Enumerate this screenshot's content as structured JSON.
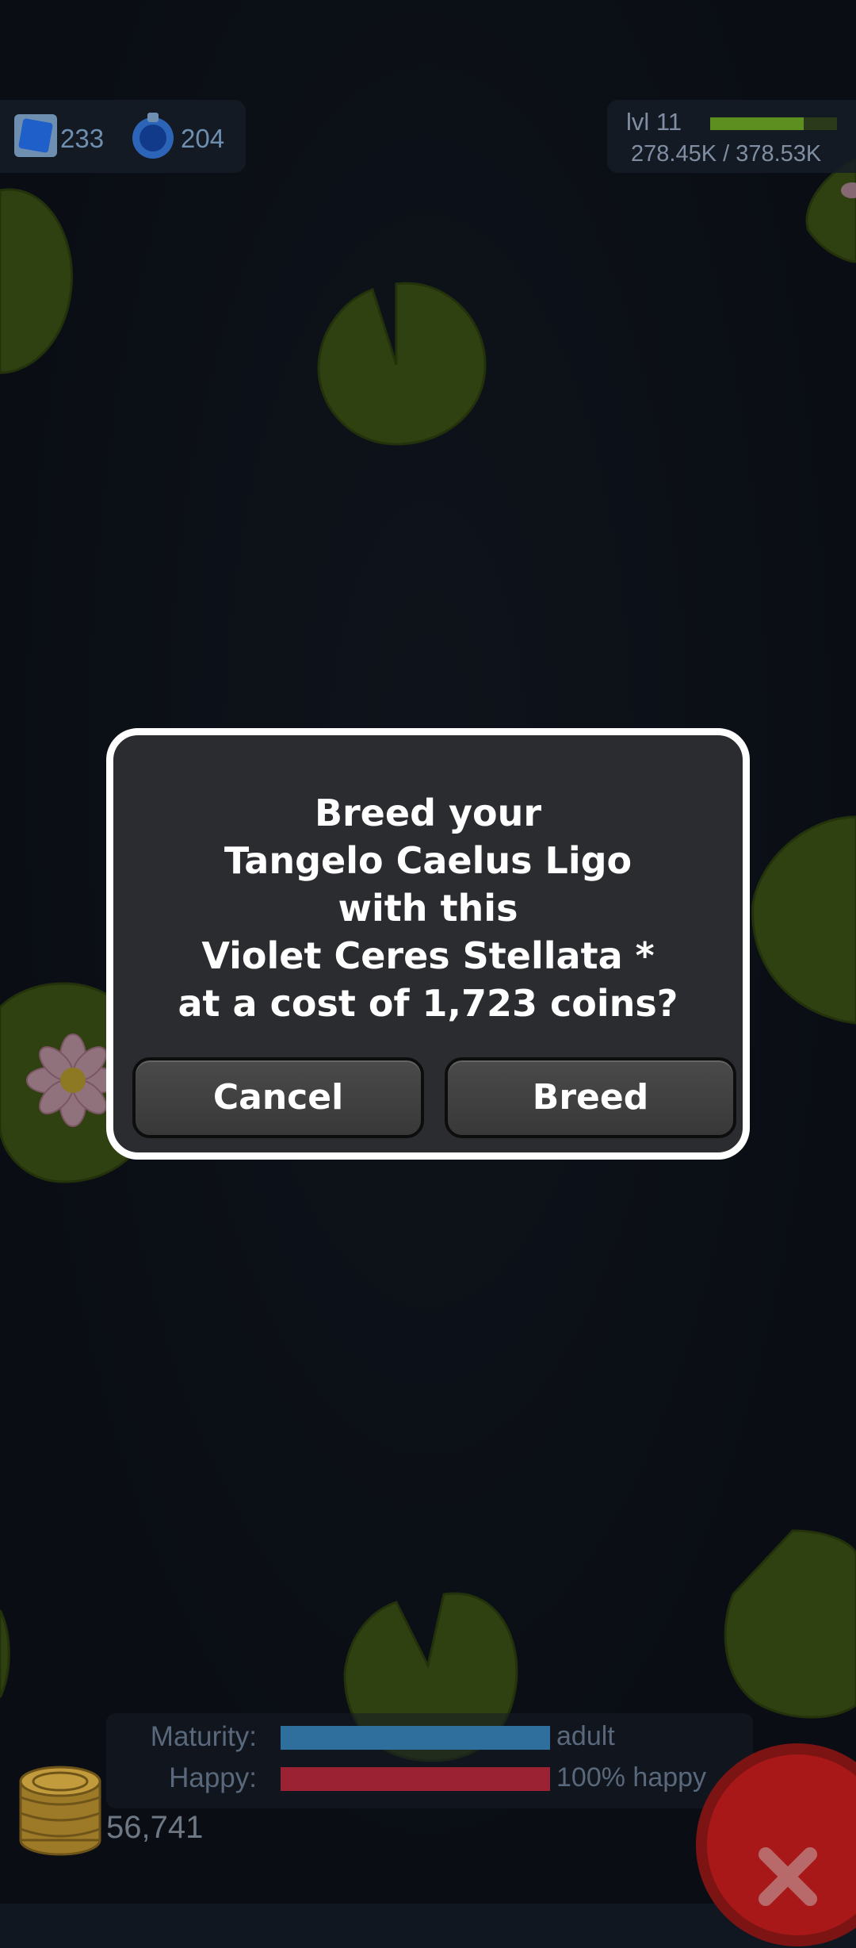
{
  "hud": {
    "gems": "233",
    "potions": "204",
    "level": "lvl 11",
    "xp_text": "278.45K / 378.53K",
    "xp_fraction": 0.736
  },
  "dialog": {
    "lines": [
      "Breed your",
      "Tangelo Caelus Ligo",
      "with this",
      "Violet Ceres Stellata *",
      "at a cost of 1,723 coins?"
    ],
    "cancel_label": "Cancel",
    "breed_label": "Breed"
  },
  "status": {
    "maturity_label": "Maturity:",
    "maturity_value": "adult",
    "maturity_fraction": 1.0,
    "happy_label": "Happy:",
    "happy_value": "100% happy",
    "happy_fraction": 1.0
  },
  "coins": "56,741",
  "colors": {
    "pad_green": "#4d6a1c",
    "maturity_bar": "#2f6f9d",
    "happy_bar": "#9b2233",
    "close_button": "#a81818"
  },
  "icons": {
    "gems": "gem-stamp-icon",
    "potions": "potion-icon",
    "coins": "coin-stack-icon",
    "close": "close-x-icon",
    "flower": "water-lily-flower-icon"
  }
}
